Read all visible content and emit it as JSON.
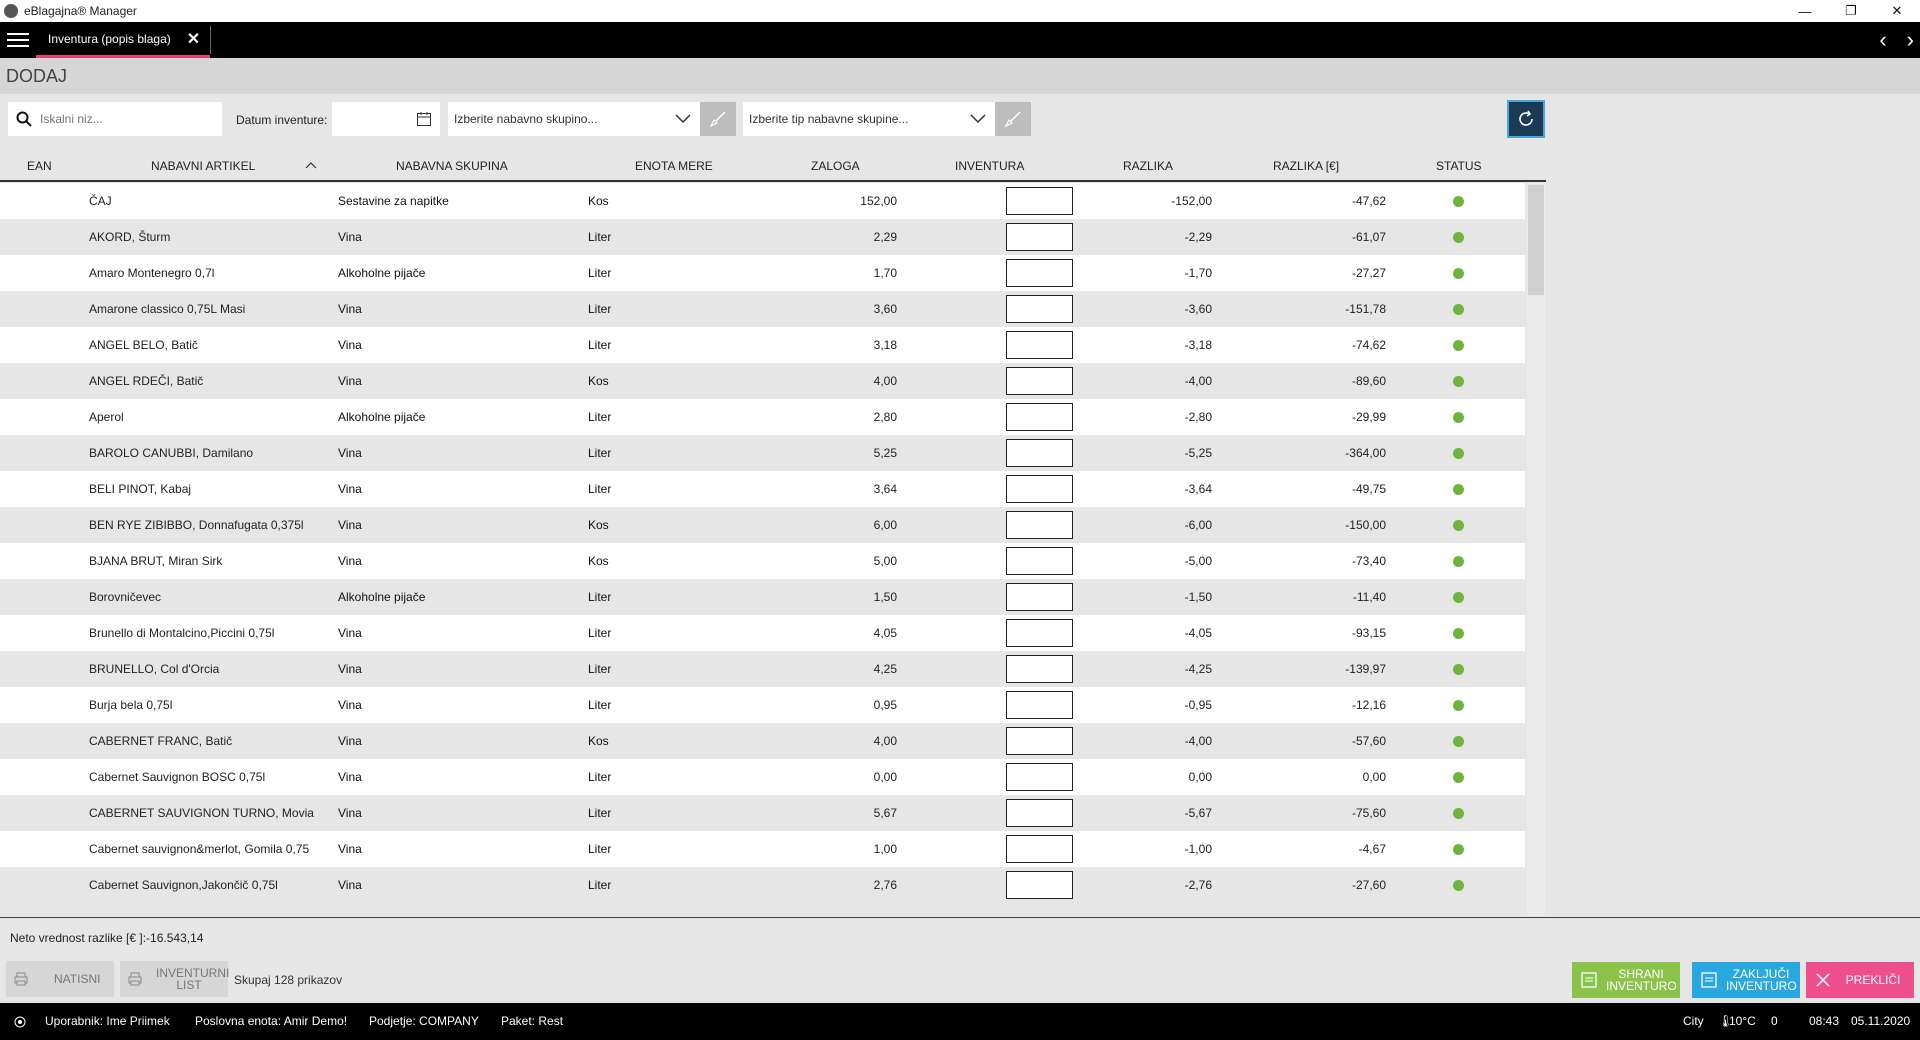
{
  "window": {
    "title": "eBlagajna® Manager",
    "min": "—",
    "restore": "❐",
    "close": "✕"
  },
  "tabbar": {
    "tab_label": "Inventura (popis blaga)",
    "close": "✕",
    "prev": "‹",
    "next": "›"
  },
  "page": {
    "heading": "DODAJ"
  },
  "filters": {
    "search_placeholder": "Iskalni niz...",
    "date_label": "Datum inventure:",
    "group_select": "Izberite nabavno skupino...",
    "type_select": "Izberite tip nabavne skupine..."
  },
  "columns": {
    "ean": "EAN",
    "artikel": "NABAVNI ARTIKEL",
    "skupina": "NABAVNA SKUPINA",
    "enota": "ENOTA MERE",
    "zaloga": "ZALOGA",
    "inventura": "INVENTURA",
    "razlika": "RAZLIKA",
    "razlika_eur": "RAZLIKA [€]",
    "status": "STATUS"
  },
  "rows": [
    {
      "artikel": "ČAJ",
      "skupina": "Sestavine za napitke",
      "enota": "Kos",
      "zaloga": "152,00",
      "razlika": "-152,00",
      "razlika_eur": "-47,62"
    },
    {
      "artikel": "AKORD, Šturm",
      "skupina": "Vina",
      "enota": "Liter",
      "zaloga": "2,29",
      "razlika": "-2,29",
      "razlika_eur": "-61,07"
    },
    {
      "artikel": "Amaro Montenegro 0,7l",
      "skupina": "Alkoholne pijače",
      "enota": "Liter",
      "zaloga": "1,70",
      "razlika": "-1,70",
      "razlika_eur": "-27,27"
    },
    {
      "artikel": "Amarone classico 0,75L Masi",
      "skupina": "Vina",
      "enota": "Liter",
      "zaloga": "3,60",
      "razlika": "-3,60",
      "razlika_eur": "-151,78"
    },
    {
      "artikel": "ANGEL BELO, Batič",
      "skupina": "Vina",
      "enota": "Liter",
      "zaloga": "3,18",
      "razlika": "-3,18",
      "razlika_eur": "-74,62"
    },
    {
      "artikel": "ANGEL RDEČI, Batič",
      "skupina": "Vina",
      "enota": "Kos",
      "zaloga": "4,00",
      "razlika": "-4,00",
      "razlika_eur": "-89,60"
    },
    {
      "artikel": "Aperol",
      "skupina": "Alkoholne pijače",
      "enota": "Liter",
      "zaloga": "2,80",
      "razlika": "-2,80",
      "razlika_eur": "-29,99"
    },
    {
      "artikel": "BAROLO CANUBBI, Damilano",
      "skupina": "Vina",
      "enota": "Liter",
      "zaloga": "5,25",
      "razlika": "-5,25",
      "razlika_eur": "-364,00"
    },
    {
      "artikel": "BELI PINOT, Kabaj",
      "skupina": "Vina",
      "enota": "Liter",
      "zaloga": "3,64",
      "razlika": "-3,64",
      "razlika_eur": "-49,75"
    },
    {
      "artikel": "BEN RYE ZIBIBBO, Donnafugata 0,375l",
      "skupina": "Vina",
      "enota": "Kos",
      "zaloga": "6,00",
      "razlika": "-6,00",
      "razlika_eur": "-150,00"
    },
    {
      "artikel": "BJANA BRUT, Miran Sirk",
      "skupina": "Vina",
      "enota": "Kos",
      "zaloga": "5,00",
      "razlika": "-5,00",
      "razlika_eur": "-73,40"
    },
    {
      "artikel": "Borovničevec",
      "skupina": "Alkoholne pijače",
      "enota": "Liter",
      "zaloga": "1,50",
      "razlika": "-1,50",
      "razlika_eur": "-11,40"
    },
    {
      "artikel": "Brunello di Montalcino,Piccini 0,75l",
      "skupina": "Vina",
      "enota": "Liter",
      "zaloga": "4,05",
      "razlika": "-4,05",
      "razlika_eur": "-93,15"
    },
    {
      "artikel": "BRUNELLO, Col d'Orcia",
      "skupina": "Vina",
      "enota": "Liter",
      "zaloga": "4,25",
      "razlika": "-4,25",
      "razlika_eur": "-139,97"
    },
    {
      "artikel": "Burja bela 0,75l",
      "skupina": "Vina",
      "enota": "Liter",
      "zaloga": "0,95",
      "razlika": "-0,95",
      "razlika_eur": "-12,16"
    },
    {
      "artikel": "CABERNET FRANC, Batič",
      "skupina": "Vina",
      "enota": "Kos",
      "zaloga": "4,00",
      "razlika": "-4,00",
      "razlika_eur": "-57,60"
    },
    {
      "artikel": "Cabernet Sauvignon BOSC 0,75l",
      "skupina": "Vina",
      "enota": "Liter",
      "zaloga": "0,00",
      "razlika": "0,00",
      "razlika_eur": "0,00"
    },
    {
      "artikel": "CABERNET SAUVIGNON TURNO, Movia",
      "skupina": "Vina",
      "enota": "Liter",
      "zaloga": "5,67",
      "razlika": "-5,67",
      "razlika_eur": "-75,60"
    },
    {
      "artikel": "Cabernet sauvignon&merlot, Gomila 0,75",
      "skupina": "Vina",
      "enota": "Liter",
      "zaloga": "1,00",
      "razlika": "-1,00",
      "razlika_eur": "-4,67"
    },
    {
      "artikel": "Cabernet Sauvignon,Jakončič 0,75l",
      "skupina": "Vina",
      "enota": "Liter",
      "zaloga": "2,76",
      "razlika": "-2,76",
      "razlika_eur": "-27,60"
    }
  ],
  "footer": {
    "neto": "Neto vrednost razlike [€ ]:-16.543,14",
    "natisni": "NATISNI",
    "inventurni_list": "INVENTURNI LIST",
    "skupaj": "Skupaj 128 prikazov",
    "shrani": "SHRANI INVENTURO",
    "zakljuci": "ZAKLJUČI INVENTURO",
    "preklici": "PREKLIČI"
  },
  "statusbar": {
    "uporabnik": "Uporabnik: Ime Priimek",
    "enota": "Poslovna enota: Amir Demo!",
    "podjetje": "Podjetje: COMPANY",
    "paket": "Paket: Rest",
    "city": "City",
    "temp": "10°C",
    "extra": "0",
    "time": "08:43",
    "date": "05.11.2020"
  },
  "colors": {
    "accent_pink": "#e0417b",
    "shrani_green": "#8bc34a",
    "zakljuci_blue": "#29a8e0",
    "preklici_pink": "#ec4f8c",
    "status_green": "#6cb33f"
  }
}
